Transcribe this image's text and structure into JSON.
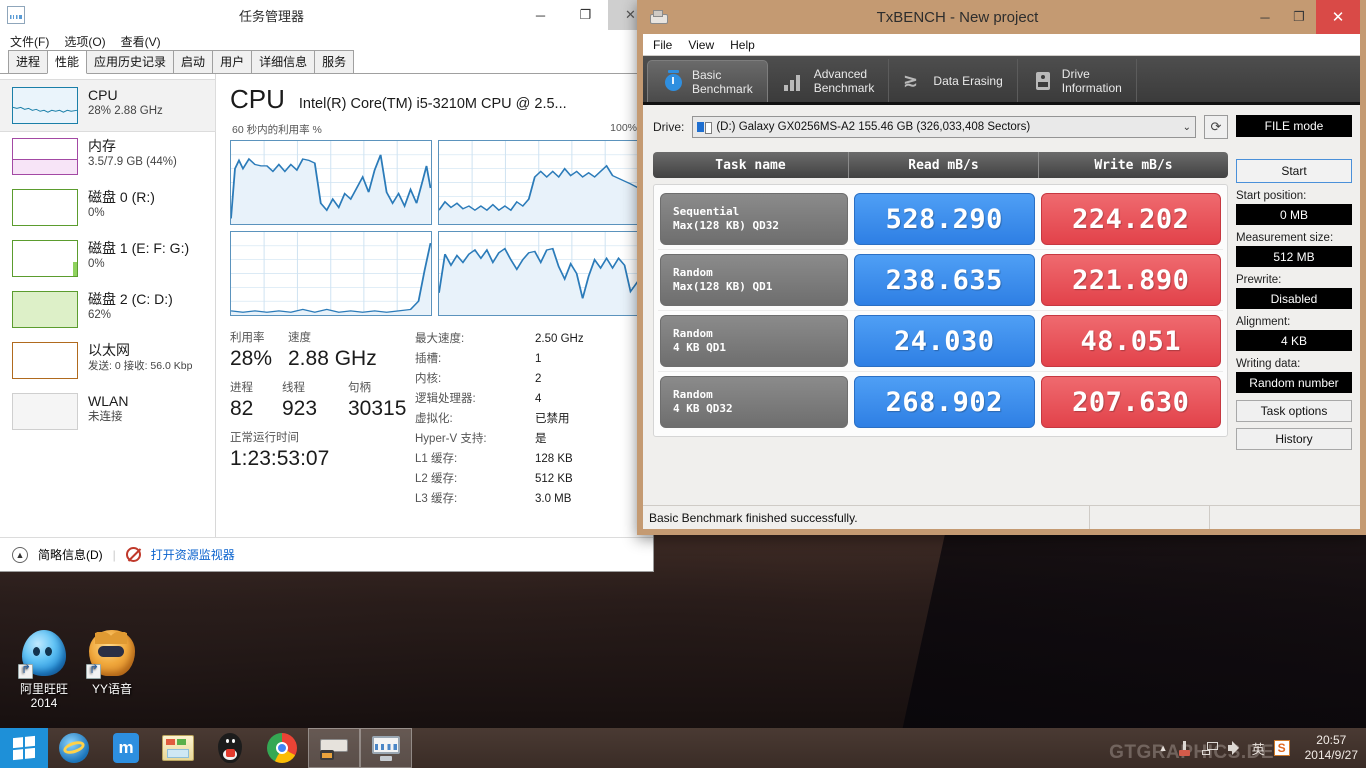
{
  "taskmanager": {
    "title": "任务管理器",
    "window_buttons": {
      "minimize": "─",
      "maximize": "❐",
      "close": "✕"
    },
    "menu": [
      "文件(F)",
      "选项(O)",
      "查看(V)"
    ],
    "tabs": [
      "进程",
      "性能",
      "应用历史记录",
      "启动",
      "用户",
      "详细信息",
      "服务"
    ],
    "selected_tab": "性能",
    "sidebar": [
      {
        "name": "CPU",
        "detail": "28% 2.88 GHz",
        "color": "#1a7fa8",
        "selected": true
      },
      {
        "name": "内存",
        "detail": "3.5/7.9 GB (44%)",
        "color": "#a349a4",
        "selected": false
      },
      {
        "name": "磁盘 0 (R:)",
        "detail": "0%",
        "color": "#5b9c2e",
        "selected": false
      },
      {
        "name": "磁盘 1 (E: F: G:)",
        "detail": "0%",
        "color": "#5b9c2e",
        "selected": false
      },
      {
        "name": "磁盘 2 (C: D:)",
        "detail": "62%",
        "color": "#5b9c2e",
        "selected": false
      },
      {
        "name": "以太网",
        "detail": "发送: 0 接收: 56.0 Kbp",
        "color": "#b06a1e",
        "selected": false
      },
      {
        "name": "WLAN",
        "detail": "未连接",
        "color": "#bdbdbd",
        "selected": false
      }
    ],
    "cpu": {
      "heading": "CPU",
      "model": "Intel(R) Core(TM) i5-3210M CPU @ 2.5...",
      "graph_caption": "60 秒内的利用率 %",
      "graph_max": "100%",
      "left_stats": [
        {
          "labels": [
            "利用率",
            "速度"
          ],
          "values": [
            "28%",
            "2.88 GHz"
          ]
        },
        {
          "labels": [
            "进程",
            "线程",
            "句柄"
          ],
          "values": [
            "82",
            "923",
            "30315"
          ]
        },
        {
          "labels": [
            "正常运行时间"
          ],
          "values": [
            "1:23:53:07"
          ]
        }
      ],
      "right_stats": [
        {
          "k": "最大速度:",
          "v": "2.50 GHz"
        },
        {
          "k": "插槽:",
          "v": "1"
        },
        {
          "k": "内核:",
          "v": "2"
        },
        {
          "k": "逻辑处理器:",
          "v": "4"
        },
        {
          "k": "虚拟化:",
          "v": "已禁用"
        },
        {
          "k": "Hyper-V 支持:",
          "v": "是"
        },
        {
          "k": "L1 缓存:",
          "v": "128 KB"
        },
        {
          "k": "L2 缓存:",
          "v": "512 KB"
        },
        {
          "k": "L3 缓存:",
          "v": "3.0 MB"
        }
      ]
    },
    "footer": {
      "less_details": "简略信息(D)",
      "resource_monitor": "打开资源监视器"
    }
  },
  "txbench": {
    "title": "TxBENCH - New project",
    "window_buttons": {
      "minimize": "─",
      "maximize": "❐",
      "close": "✕"
    },
    "menu": [
      "File",
      "View",
      "Help"
    ],
    "tabs": [
      {
        "label_line1": "Basic",
        "label_line2": "Benchmark",
        "icon": "stopwatch-icon",
        "selected": true
      },
      {
        "label_line1": "Advanced",
        "label_line2": "Benchmark",
        "icon": "bar-chart-icon",
        "selected": false
      },
      {
        "label_line1": "Data Erasing",
        "label_line2": "",
        "icon": "erase-icon",
        "selected": false
      },
      {
        "label_line1": "Drive",
        "label_line2": "Information",
        "icon": "drive-icon",
        "selected": false
      }
    ],
    "drive": {
      "label": "Drive:",
      "value": "(D:) Galaxy GX0256MS-A2  155.46 GB (326,033,408 Sectors)",
      "refresh_icon": "refresh-icon",
      "caret": "⌄"
    },
    "results_header": {
      "task": "Task name",
      "read": "Read mB/s",
      "write": "Write mB/s"
    },
    "results": [
      {
        "task_line1": "Sequential",
        "task_line2": "Max(128 KB) QD32",
        "read": "528.290",
        "write": "224.202"
      },
      {
        "task_line1": "Random",
        "task_line2": "Max(128 KB) QD1",
        "read": "238.635",
        "write": "221.890"
      },
      {
        "task_line1": "Random",
        "task_line2": "4 KB QD1",
        "read": "24.030",
        "write": "48.051"
      },
      {
        "task_line1": "Random",
        "task_line2": "4 KB QD32",
        "read": "268.902",
        "write": "207.630"
      }
    ],
    "panel": {
      "mode": "FILE mode",
      "start_button": "Start",
      "options": [
        {
          "label": "Start position:",
          "value": "0 MB"
        },
        {
          "label": "Measurement size:",
          "value": "512 MB"
        },
        {
          "label": "Prewrite:",
          "value": "Disabled"
        },
        {
          "label": "Alignment:",
          "value": "4 KB"
        },
        {
          "label": "Writing data:",
          "value": "Random number"
        }
      ],
      "task_options": "Task options",
      "history": "History"
    },
    "status": "Basic Benchmark finished successfully.",
    "colors": {
      "read": "#2e7fe4",
      "write": "#e2424a",
      "titlebar": "#c49a72"
    }
  },
  "desktop": {
    "icons": [
      {
        "label_line1": "阿里旺旺",
        "label_line2": "2014",
        "icon": "aliwangwang-icon"
      },
      {
        "label_line1": "YY语音",
        "label_line2": "",
        "icon": "yy-voice-icon"
      }
    ],
    "watermark": "GTGRAPHICS.DE"
  },
  "taskbar": {
    "start_icon": "windows-logo-icon",
    "items": [
      {
        "name": "internet-explorer",
        "icon": "ie-icon",
        "active": false
      },
      {
        "name": "maxthon-browser",
        "icon": "maxthon-icon",
        "active": false
      },
      {
        "name": "file-explorer",
        "icon": "folder-icon",
        "active": false
      },
      {
        "name": "qq-messenger",
        "icon": "qq-penguin-icon",
        "active": false
      },
      {
        "name": "google-chrome",
        "icon": "chrome-icon",
        "active": false
      },
      {
        "name": "txbench",
        "icon": "txbench-icon",
        "active": true
      },
      {
        "name": "task-manager",
        "icon": "task-manager-icon",
        "active": true
      }
    ],
    "tray": {
      "overflow": "▲",
      "icons": [
        "usb-icon",
        "network-icon",
        "volume-icon"
      ],
      "ime": "英",
      "sogou": "S",
      "time": "20:57",
      "date": "2014/9/27"
    }
  }
}
